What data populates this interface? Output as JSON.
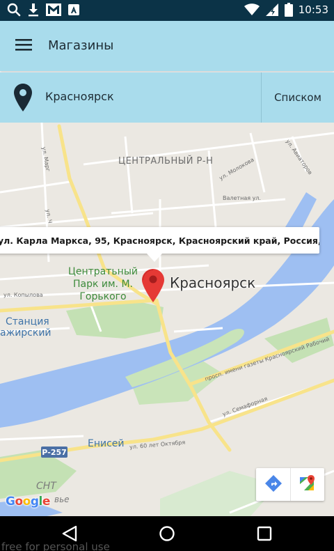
{
  "status_bar": {
    "time": "10:53",
    "notification_icons": [
      "search-icon",
      "download-icon",
      "gmail-icon",
      "font-app-icon"
    ],
    "system_icons": [
      "wifi-icon",
      "signal-icon",
      "battery-icon"
    ]
  },
  "app_bar": {
    "title": "Магазины",
    "menu_icon": "hamburger-menu-icon"
  },
  "city_bar": {
    "city": "Красноярск",
    "pin_icon": "location-pin-icon",
    "list_button": "Списком"
  },
  "map": {
    "info_window": "ул. Карла Маркса, 95, Красноярск, Красноярский край, Россия,...",
    "labels": {
      "district": "ЦЕНТРАЛЬНЫЙ Р-Н",
      "city": "Красноярск",
      "park_line1": "Центратьный",
      "park_line2": "Парк им. М.",
      "park_line3": "Горького",
      "station_line1": "Станция",
      "station_line2": "ажирский",
      "yenisei": "Енисей",
      "route": "Р-257",
      "cnt": "СНТ",
      "cnt_suffix": "вье",
      "street_molokova": "ул. Молокова",
      "street_valetnaya": "Валетная ул.",
      "street_aviatorov": "ул. Авиаторов",
      "street_kopylova": "ул. Копылова",
      "street_gazety": "просп. имени газеты Красноярский Рабочий",
      "street_semafornaya": "ул. Семафорная",
      "street_60let": "ул. 60 лет Октября",
      "street_margo": "ул. Марг",
      "street_ul": "ул. Ч"
    },
    "colors": {
      "water": "#9ebff2",
      "park": "#c4e1b4",
      "land": "#ebe8e2",
      "road_major": "#f8e38a",
      "marker": "#e53935"
    },
    "controls": {
      "directions_icon": "directions-icon",
      "maps_app_icon": "google-maps-icon"
    },
    "logo": {
      "letters": [
        "G",
        "o",
        "o",
        "g",
        "l",
        "e"
      ],
      "colors": [
        "#4285f4",
        "#ea4335",
        "#fbbc05",
        "#4285f4",
        "#34a853",
        "#ea4335"
      ]
    }
  },
  "nav_bar": {
    "icons": [
      "back-icon",
      "home-icon",
      "recents-icon"
    ]
  },
  "watermark": "free for personal use"
}
